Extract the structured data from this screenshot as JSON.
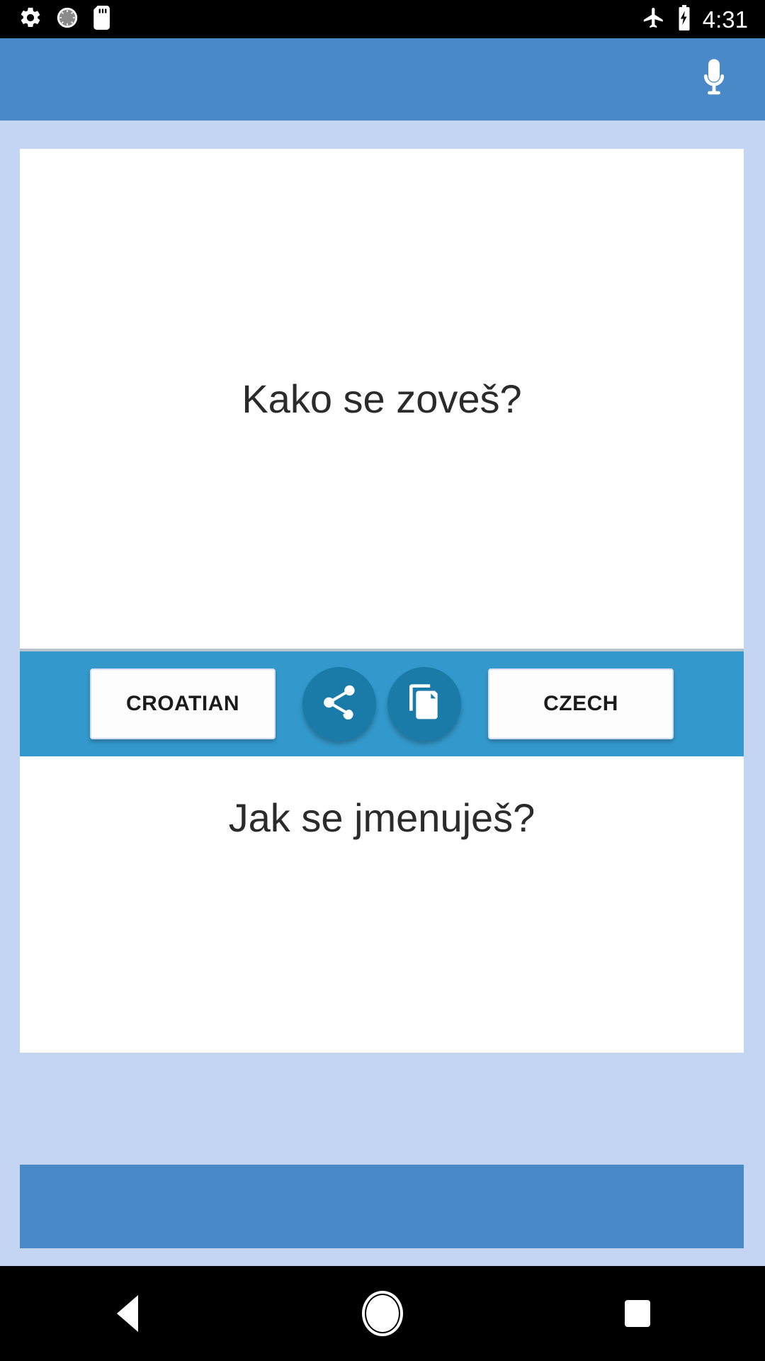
{
  "status_bar": {
    "time": "4:31",
    "icons_left": [
      "settings-gear-icon",
      "dial-icon",
      "sd-card-icon"
    ],
    "icons_right": [
      "airplane-mode-icon",
      "battery-charging-icon"
    ]
  },
  "app_bar": {
    "background_color": "#4a89c8",
    "mic_icon": "microphone-icon"
  },
  "translator": {
    "source_text": "Kako se zoveš?",
    "target_text": "Jak se jmenuješ?",
    "source_language": "CROATIAN",
    "target_language": "CZECH",
    "share_icon": "share-icon",
    "copy_icon": "copy-icon",
    "toolbar_color": "#3399cc",
    "fab_color": "#1a7ba8"
  },
  "ad_banner": {
    "background_color": "#4a89c8"
  },
  "nav_bar": {
    "back": "back-triangle-icon",
    "home": "home-circle-icon",
    "recents": "recents-square-icon"
  },
  "theme": {
    "page_background": "#c3d5f2",
    "card_background": "#ffffff",
    "text_color": "#2b2b2b"
  }
}
